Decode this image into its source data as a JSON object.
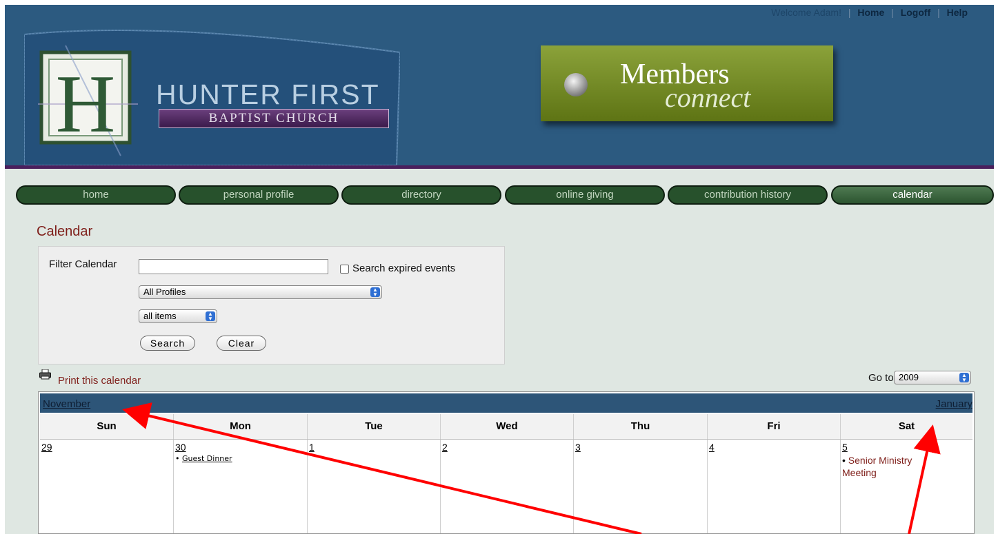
{
  "top_links": {
    "welcome": "Welcome Adam!",
    "home": "Home",
    "logoff": "Logoff",
    "help": "Help"
  },
  "logo": {
    "letter": "H",
    "name": "HUNTER FIRST",
    "subtitle": "BAPTIST CHURCH"
  },
  "members_badge": {
    "line1": "Members",
    "line2": "connect"
  },
  "nav": [
    {
      "label": "home"
    },
    {
      "label": "personal profile"
    },
    {
      "label": "directory"
    },
    {
      "label": "online giving"
    },
    {
      "label": "contribution history"
    },
    {
      "label": "calendar"
    }
  ],
  "page_title": "Calendar",
  "filter": {
    "label": "Filter Calendar",
    "input_value": "",
    "expired_label": "Search expired events",
    "expired_checked": false,
    "profile_select": "All Profiles",
    "items_select": "all items",
    "search_label": "Search",
    "clear_label": "Clear"
  },
  "print_label": "Print this calendar",
  "goto": {
    "label": "Go to",
    "year": "2009"
  },
  "calendar": {
    "prev_month": "November",
    "next_month": "January",
    "days": [
      "Sun",
      "Mon",
      "Tue",
      "Wed",
      "Thu",
      "Fri",
      "Sat"
    ],
    "dates": [
      "29",
      "30",
      "1",
      "2",
      "3",
      "4",
      "5"
    ],
    "events": {
      "mon": "Guest Dinner",
      "sat": "Senior Ministry Meeting"
    }
  },
  "colors": {
    "header": "#2c5a80",
    "nav_tab": "#27512c",
    "accent_red": "#7f1f1a",
    "annotation_arrow": "#ff0000"
  }
}
